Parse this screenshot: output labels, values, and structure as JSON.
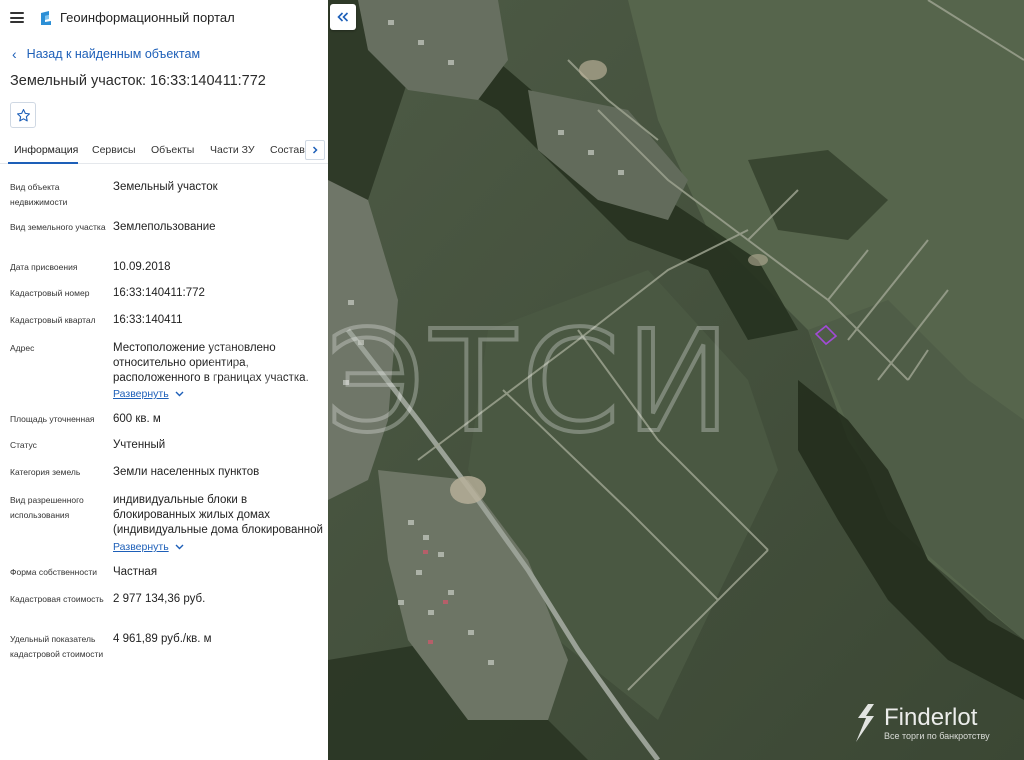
{
  "header": {
    "portal_title": "Геоинформационный портал"
  },
  "nav": {
    "back_label": "Назад к найденным объектам"
  },
  "object": {
    "title": "Земельный участок: 16:33:140411:772"
  },
  "tabs": [
    {
      "label": "Информация",
      "active": true
    },
    {
      "label": "Сервисы"
    },
    {
      "label": "Объекты"
    },
    {
      "label": "Части ЗУ"
    },
    {
      "label": "Состав"
    }
  ],
  "info": {
    "object_type": {
      "label": "Вид объекта недвижимости",
      "value": "Земельный участок"
    },
    "parcel_kind": {
      "label": "Вид земельного участка",
      "value": "Землепользование"
    },
    "assign_date": {
      "label": "Дата присвоения",
      "value": "10.09.2018"
    },
    "cadastral_number": {
      "label": "Кадастровый номер",
      "value": "16:33:140411:772"
    },
    "cadastral_quarter": {
      "label": "Кадастровый квартал",
      "value": "16:33:140411"
    },
    "address": {
      "label": "Адрес",
      "value": "Местоположение установлено относительно ориентира, расположенного в границах участка.",
      "expand": "Развернуть"
    },
    "area": {
      "label": "Площадь уточненная",
      "value": "600 кв. м"
    },
    "status": {
      "label": "Статус",
      "value": "Учтенный"
    },
    "land_category": {
      "label": "Категория земель",
      "value": "Земли населенных пунктов"
    },
    "permitted_use": {
      "label": "Вид разрешенного использования",
      "value": "индивидуальные блоки в блокированных жилых домах (индивидуальные дома блокированной",
      "expand": "Развернуть"
    },
    "ownership": {
      "label": "Форма собственности",
      "value": "Частная"
    },
    "cadastral_value": {
      "label": "Кадастровая стоимость",
      "value": "2 977 134,36 руб."
    },
    "unit_value": {
      "label": "Удельный показатель кадастровой стоимости",
      "value": "4 961,89 руб./кв. м"
    }
  },
  "map": {
    "watermark_text": "МЭТСИ",
    "brand": "Finderlot",
    "brand_tagline": "Все торги по банкротству"
  },
  "colors": {
    "accent": "#1d5fb8",
    "parcel_outline": "#a14bd6"
  }
}
